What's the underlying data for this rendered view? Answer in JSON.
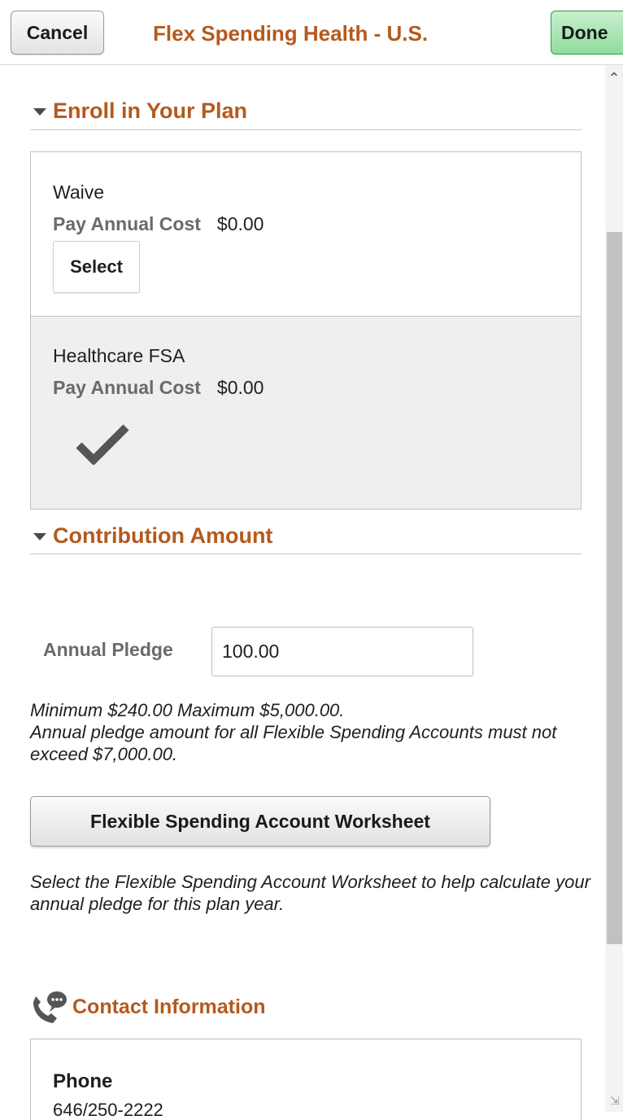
{
  "header": {
    "cancel_label": "Cancel",
    "title": "Flex Spending Health - U.S.",
    "done_label": "Done"
  },
  "enroll": {
    "section_title": "Enroll in Your Plan",
    "plans": [
      {
        "name": "Waive",
        "cost_label": "Pay Annual Cost",
        "cost_value": "$0.00",
        "action_label": "Select",
        "selected": false
      },
      {
        "name": "Healthcare FSA",
        "cost_label": "Pay Annual Cost",
        "cost_value": "$0.00",
        "selected": true
      }
    ]
  },
  "contribution": {
    "section_title": "Contribution Amount",
    "pledge_label": "Annual Pledge",
    "pledge_value": "100.00",
    "limits_note_line1": "Minimum $240.00 Maximum $5,000.00.",
    "limits_note_line2": "Annual pledge amount for all Flexible Spending Accounts must not exceed $7,000.00.",
    "worksheet_button_label": "Flexible Spending Account Worksheet",
    "worksheet_note": "Select the Flexible Spending Account Worksheet to help calculate your annual pledge for this plan year."
  },
  "contact": {
    "section_title": "Contact Information",
    "phone_label": "Phone",
    "phone_value": "646/250-2222"
  },
  "colors": {
    "accent_title": "#b45a1e",
    "done_button": "#8fdc9c",
    "selected_row_bg": "#efefef"
  },
  "icons": {
    "section_toggle": "caret-down-icon",
    "selected_plan": "checkmark-icon",
    "contact": "phone-chat-icon"
  }
}
